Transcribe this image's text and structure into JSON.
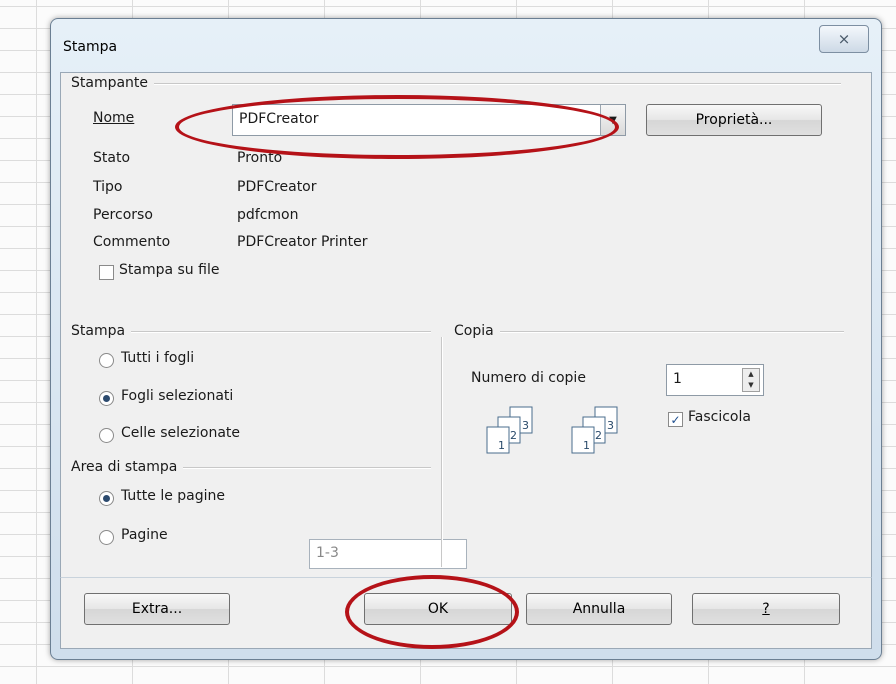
{
  "dialog": {
    "title": "Stampa",
    "close_glyph": "⨯"
  },
  "printer": {
    "group_label": "Stampante",
    "name_label": "Nome",
    "name_value": "PDFCreator",
    "properties_button": "Proprietà...",
    "status_label": "Stato",
    "status_value": "Pronto",
    "type_label": "Tipo",
    "type_value": "PDFCreator",
    "path_label": "Percorso",
    "path_value": "pdfcmon",
    "comment_label": "Commento",
    "comment_value": "PDFCreator Printer",
    "print_to_file_label": "Stampa su file",
    "print_to_file_checked": false
  },
  "print_range": {
    "group_label": "Stampa",
    "options": [
      "Tutti i fogli",
      "Fogli selezionati",
      "Celle selezionate"
    ],
    "selected": "Fogli selezionati"
  },
  "print_area": {
    "group_label": "Area di stampa",
    "options": [
      "Tutte le pagine",
      "Pagine"
    ],
    "selected": "Tutte le pagine",
    "pages_value": "1-3"
  },
  "copies": {
    "group_label": "Copia",
    "count_label": "Numero di copie",
    "count_value": "1",
    "collate_label": "Fascicola",
    "collate_checked": true,
    "icon_digits": [
      "1",
      "2",
      "3"
    ]
  },
  "buttons": {
    "extra": "Extra...",
    "ok": "OK",
    "cancel": "Annulla",
    "help": "?"
  },
  "colors": {
    "annotation": "#b51218",
    "title_bar": "#dbe7f2"
  },
  "icons": [
    "close-icon",
    "dropdown-arrow-icon",
    "spin-up-icon",
    "spin-down-icon",
    "collated-copies-icon",
    "uncollated-copies-icon"
  ]
}
